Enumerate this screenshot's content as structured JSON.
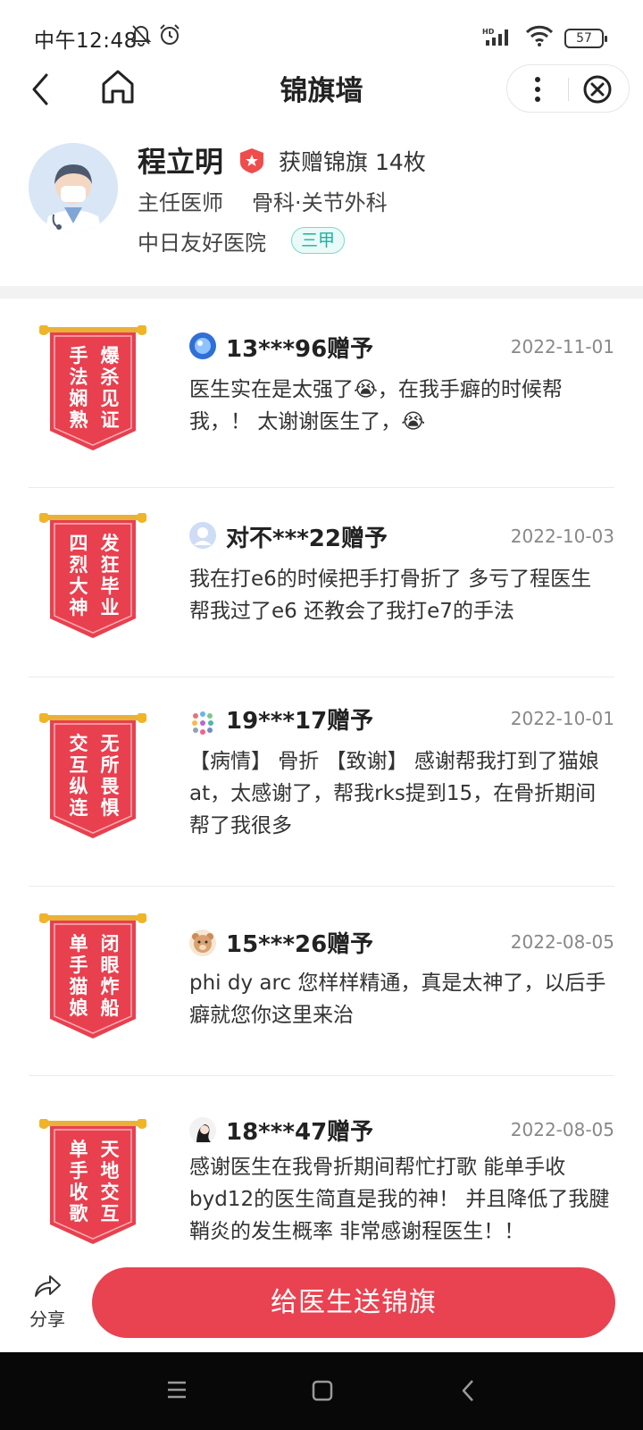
{
  "status_bar": {
    "time": "中午12:48",
    "battery": "57"
  },
  "nav": {
    "title": "锦旗墙"
  },
  "doctor": {
    "name": "程立明",
    "flag_count_text": "获赠锦旗 14枚",
    "title": "主任医师",
    "department": "骨科·关节外科",
    "hospital": "中日友好医院",
    "hospital_level": "三甲"
  },
  "flags": [
    {
      "banner_right": "爆杀见证",
      "banner_left": "手法娴熟",
      "giver": "13***96赠予",
      "date": "2022-11-01",
      "message": "医生实在是太强了😭，在我手癖的时候帮我，！ 太谢谢医生了，😭"
    },
    {
      "banner_right": "发狂毕业",
      "banner_left": "四烈大神",
      "giver": "对不***22赠予",
      "date": "2022-10-03",
      "message": "我在打e6的时候把手打骨折了 多亏了程医生 帮我过了e6 还教会了我打e7的手法"
    },
    {
      "banner_right": "无所畏惧",
      "banner_left": "交互纵连",
      "giver": "19***17赠予",
      "date": "2022-10-01",
      "message": "【病情】 骨折 【致谢】 感谢帮我打到了猫娘at，太感谢了，帮我rks提到15，在骨折期间帮了我很多"
    },
    {
      "banner_right": "闭眼炸船",
      "banner_left": "单手猫娘",
      "giver": "15***26赠予",
      "date": "2022-08-05",
      "message": "phi dy arc 您样样精通，真是太神了，以后手癖就您你这里来治"
    },
    {
      "banner_right": "天地交互",
      "banner_left": "单手收歌",
      "giver": "18***47赠予",
      "date": "2022-08-05",
      "message": "感谢医生在我骨折期间帮忙打歌 能单手收byd12的医生简直是我的神！ 并且降低了我腱鞘炎的发生概率 非常感谢程医生！！"
    }
  ],
  "bottom": {
    "share_label": "分享",
    "send_label": "给医生送锦旗"
  },
  "colors": {
    "accent_red": "#e94251",
    "banner_red": "#e8404f",
    "hospital_tag": "#19b3a5"
  }
}
